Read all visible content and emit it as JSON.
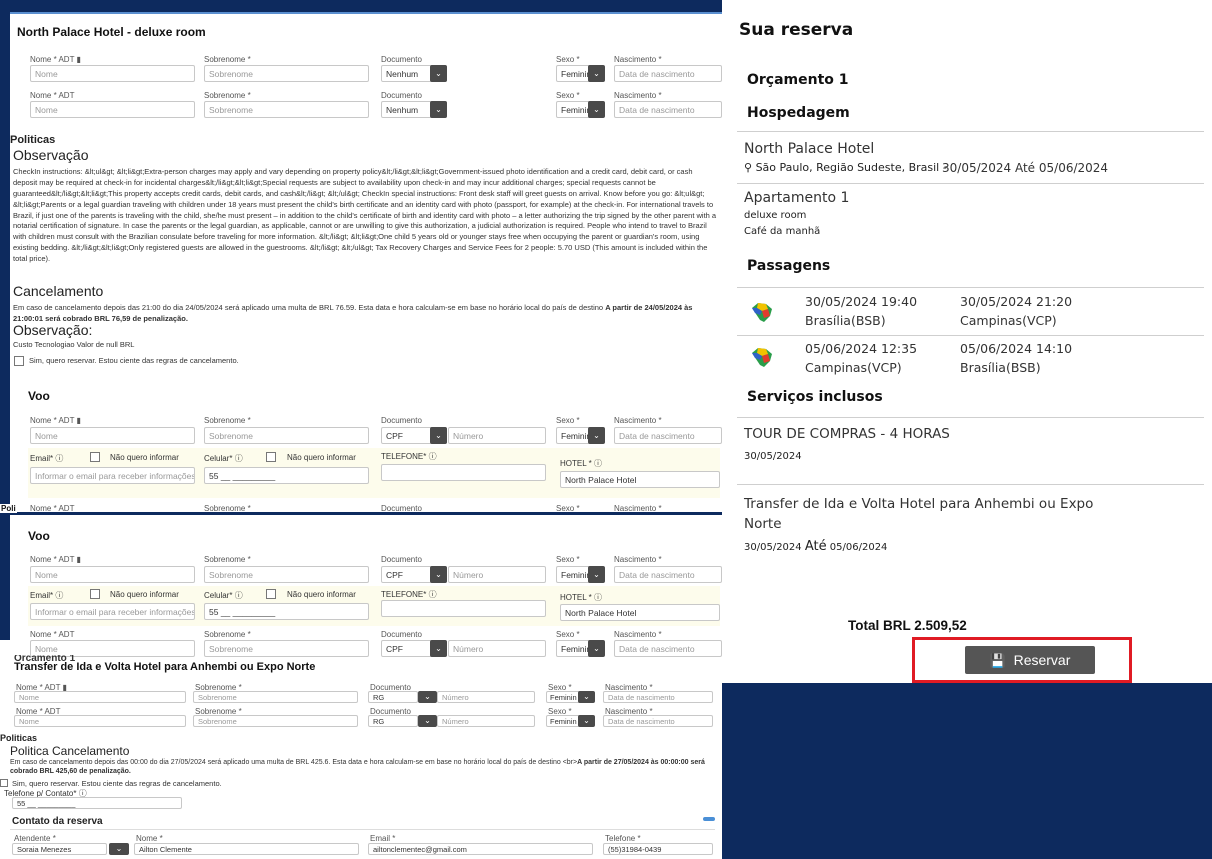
{
  "hotel_form": {
    "title": "North Palace Hotel - deluxe room",
    "row1": {
      "nome_label": "Nome * ADT",
      "nome_placeholder": "Nome",
      "sobrenome_label": "Sobrenome *",
      "sobrenome_placeholder": "Sobrenome",
      "documento_label": "Documento",
      "documento_value": "Nenhum",
      "sexo_label": "Sexo *",
      "sexo_value": "Feminin",
      "nasc_label": "Nascimento *",
      "nasc_placeholder": "Data de nascimento"
    },
    "row2": {
      "nome_label": "Nome * ADT",
      "nome_placeholder": "Nome",
      "sobrenome_label": "Sobrenome *",
      "sobrenome_placeholder": "Sobrenome",
      "documento_label": "Documento",
      "documento_value": "Nenhum",
      "sexo_label": "Sexo *",
      "sexo_value": "Feminin",
      "nasc_label": "Nascimento *",
      "nasc_placeholder": "Data de nascimento"
    },
    "politicas": "Politicas",
    "observacao": "Observação",
    "observacao_text": "CheckIn instructions: &lt;ul&gt; &lt;li&gt;Extra-person charges may apply and vary depending on property policy&lt;/li&gt;&lt;li&gt;Government-issued photo identification and a credit card, debit card, or cash deposit may be required at check-in for incidental charges&lt;/li&gt;&lt;li&gt;Special requests are subject to availability upon check-in and may incur additional charges; special requests cannot be guaranteed&lt;/li&gt;&lt;li&gt;This property accepts credit cards, debit cards, and cash&lt;/li&gt; &lt;/ul&gt; CheckIn special instructions: Front desk staff will greet guests on arrival. Know before you go: &lt;ul&gt; &lt;li&gt;Parents or a legal guardian traveling with children under 18 years must present the child's birth certificate and an identity card with photo (passport, for example) at the check-in. For international travels to Brazil, if just one of the parents is traveling with the child, she/he must present – in addition to the child's certificate of birth and identity card with photo – a letter authorizing the trip signed by the other parent with a notarial certification of signature. In case the parents or the legal guardian, as applicable, cannot or are unwilling to give this authorization, a judicial authorization is required. People who intend to travel to Brazil with children must consult with the Brazilian consulate before traveling for more information. &lt;/li&gt; &lt;li&gt;One child 5 years old or younger stays free when occupying the parent or guardian's room, using existing bedding. &lt;/li&gt;&lt;li&gt;Only registered guests are allowed in the guestrooms. &lt;/li&gt; &lt;/ul&gt; Tax Recovery Charges and Service Fees for 2 people: 5.70 USD (This amount is included within the total price).",
    "cancelamento": "Cancelamento",
    "cancel_text": "Em caso de cancelamento depois das 21:00 do dia 24/05/2024 será aplicado uma multa de BRL 76.59. Esta data e hora calculam-se em base no horário local do país de destino ",
    "cancel_bold": "A partir de 24/05/2024 às 21:00:01 será cobrado BRL 76,59 de penalização.",
    "observacao2": "Observação:",
    "custo": "Custo Tecnologiao Valor de null BRL",
    "checkbox_label": "Sim, quero reservar. Estou ciente das regras de cancelamento.",
    "voo_title": "Voo",
    "voo": {
      "nome_label": "Nome * ADT",
      "nome_placeholder": "Nome",
      "sobrenome_label": "Sobrenome *",
      "sobrenome_placeholder": "Sobrenome",
      "documento_label": "Documento",
      "documento_value": "CPF",
      "numero_placeholder": "Número",
      "sexo_label": "Sexo *",
      "sexo_value": "Feminin",
      "nasc_label": "Nascimento *",
      "nasc_placeholder": "Data de nascimento",
      "email_label": "Email*",
      "email_placeholder": "Informar o email para receber informações",
      "nao_quero": "Não quero informar",
      "celular_label": "Celular*",
      "celular_value": "55 __ _________",
      "telefone_label": "TELEFONE*",
      "hotel_label": "HOTEL *",
      "hotel_value": "North Palace Hotel"
    },
    "cut_labels": {
      "nome": "Nome * ADT",
      "sobrenome": "Sobrenome *",
      "documento": "Documento",
      "sexo": "Sexo *",
      "nasc": "Nascimento *",
      "stray": "Poli"
    }
  },
  "voo_panel": {
    "title": "Voo",
    "voo": {
      "nome_label": "Nome * ADT",
      "nome_placeholder": "Nome",
      "sobrenome_label": "Sobrenome *",
      "sobrenome_placeholder": "Sobrenome",
      "documento_label": "Documento",
      "documento_value": "CPF",
      "numero_placeholder": "Número",
      "sexo_label": "Sexo *",
      "sexo_value": "Feminin",
      "nasc_label": "Nascimento *",
      "nasc_placeholder": "Data de nascimento",
      "email_label": "Email*",
      "email_placeholder": "Informar o email para receber informações",
      "nao_quero": "Não quero informar",
      "celular_label": "Celular*",
      "celular_value": "55 __ _________",
      "telefone_label": "TELEFONE*",
      "hotel_label": "HOTEL *",
      "hotel_value": "North Palace Hotel"
    },
    "row2": {
      "nome_label": "Nome * ADT",
      "nome_placeholder": "Nome",
      "sobrenome_label": "Sobrenome *",
      "sobrenome_placeholder": "Sobrenome",
      "documento_label": "Documento",
      "documento_value": "CPF",
      "numero_placeholder": "Número",
      "sexo_label": "Sexo *",
      "sexo_value": "Feminin",
      "nasc_label": "Nascimento *",
      "nasc_placeholder": "Data de nascimento"
    }
  },
  "transfer_panel": {
    "orcamento_cut": "Orçamento 1",
    "title": "Transfer de Ida e Volta Hotel para Anhembi ou Expo Norte",
    "row1": {
      "nome_label": "Nome * ADT",
      "nome_placeholder": "Nome",
      "sobrenome_label": "Sobrenome *",
      "sobrenome_placeholder": "Sobrenome",
      "documento_label": "Documento",
      "documento_value": "RG",
      "numero_placeholder": "Número",
      "sexo_label": "Sexo *",
      "sexo_value": "Feminin",
      "nasc_label": "Nascimento *",
      "nasc_placeholder": "Data de nascimento"
    },
    "row2": {
      "nome_label": "Nome * ADT",
      "nome_placeholder": "Nome",
      "sobrenome_label": "Sobrenome *",
      "sobrenome_placeholder": "Sobrenome",
      "documento_label": "Documento",
      "documento_value": "RG",
      "numero_placeholder": "Número",
      "sexo_label": "Sexo *",
      "sexo_value": "Feminin",
      "nasc_label": "Nascimento *",
      "nasc_placeholder": "Data de nascimento"
    },
    "politicas": "Politicas",
    "politica_cancel": "Politica Cancelamento",
    "cancel_text": "Em caso de cancelamento depois das 00:00 do dia 27/05/2024 será aplicado uma multa de BRL 425.6. Esta data e hora calculam-se em base no horário local do país de destino <br>",
    "cancel_bold": "A partir de 27/05/2024 às 00:00:00 será cobrado BRL 425,60 de penalização.",
    "checkbox_label": "Sim, quero reservar. Estou ciente das regras de cancelamento.",
    "telefone_label": "Telefone p/ Contato*",
    "telefone_value": "55 __ _________",
    "contato_title": "Contato da reserva",
    "atendente_label": "Atendente *",
    "atendente_value": "Soraia Menezes",
    "nome_label": "Nome *",
    "nome_value": "Ailton Clemente",
    "email_label": "Email *",
    "email_value": "ailtonclementec@gmail.com",
    "tel_label": "Telefone *",
    "tel_value": "(55)31984-0439"
  },
  "summary": {
    "title": "Sua reserva",
    "orcamento": "Orçamento 1",
    "hospedagem": "Hospedagem",
    "hotel_name": "North Palace Hotel",
    "hotel_location": "São Paulo, Região Sudeste, Brasil -",
    "hotel_dates": "30/05/2024 Até 05/06/2024",
    "apartamento": "Apartamento 1",
    "room": "deluxe room",
    "meal": "Café da manhã",
    "passagens": "Passagens",
    "flights": [
      {
        "dep_time": "30/05/2024 19:40",
        "dep_place": "Brasília(BSB)",
        "arr_time": "30/05/2024 21:20",
        "arr_place": "Campinas(VCP)"
      },
      {
        "dep_time": "05/06/2024 12:35",
        "dep_place": "Campinas(VCP)",
        "arr_time": "05/06/2024 14:10",
        "arr_place": "Brasília(BSB)"
      }
    ],
    "servicos": "Serviços inclusos",
    "service1_name": "TOUR DE COMPRAS - 4 HORAS",
    "service1_date": "30/05/2024",
    "service2_name": "Transfer de Ida e Volta Hotel para Anhembi ou Expo Norte",
    "service2_date_start": "30/05/2024",
    "service2_ate": "Até",
    "service2_date_end": "05/06/2024",
    "total": "Total BRL 2.509,52",
    "reservar": "Reservar"
  },
  "colors": {
    "background": "#0d2a5e",
    "button": "#555555",
    "highlight": "#e01b24",
    "field_highlight": "#fdfcec"
  }
}
